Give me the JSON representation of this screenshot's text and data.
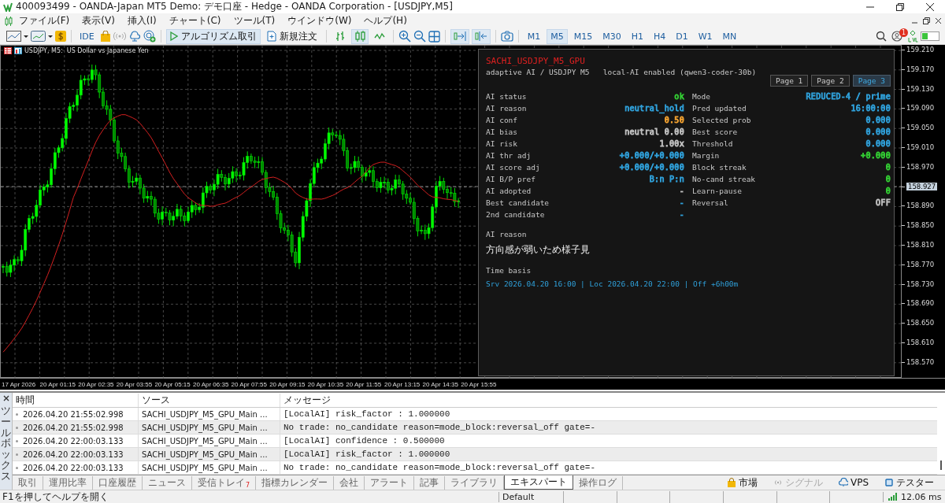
{
  "window": {
    "title": "400093499 - OANDA-Japan MT5 Demo: デモ口座 - Hedge - OANDA Corporation - [USDJPY,M5]"
  },
  "menu": [
    "ファイル(F)",
    "表示(V)",
    "挿入(I)",
    "チャート(C)",
    "ツール(T)",
    "ウインドウ(W)",
    "ヘルプ(H)"
  ],
  "toolbar": {
    "ide_label": "IDE",
    "algo_trading": {
      "label": "アルゴリズム取引",
      "on": true
    },
    "new_order": {
      "label": "新規注文"
    },
    "chart_types": [
      {
        "selected": false
      },
      {
        "selected": true
      },
      {
        "selected": false
      }
    ],
    "autoscroll": {
      "on": true
    },
    "chart_shift": {
      "on": true
    },
    "timeframes": [
      {
        "label": "M1",
        "selected": false
      },
      {
        "label": "M5",
        "selected": true
      },
      {
        "label": "M15",
        "selected": false
      },
      {
        "label": "M30",
        "selected": false
      },
      {
        "label": "H1",
        "selected": false
      },
      {
        "label": "H4",
        "selected": false
      },
      {
        "label": "D1",
        "selected": false
      },
      {
        "label": "W1",
        "selected": false
      },
      {
        "label": "MN",
        "selected": false
      }
    ],
    "notifications_badge": "1"
  },
  "chart": {
    "title": "USDJPY, M5:  US Dollar vs Japanese Yen",
    "price_axis": [
      {
        "label": "159.210",
        "current": false
      },
      {
        "label": "159.170",
        "current": false
      },
      {
        "label": "159.130",
        "current": false
      },
      {
        "label": "159.090",
        "current": false
      },
      {
        "label": "159.050",
        "current": false
      },
      {
        "label": "159.010",
        "current": false
      },
      {
        "label": "158.970",
        "current": false
      },
      {
        "label": "158.927",
        "current": true
      },
      {
        "label": "158.890",
        "current": false
      },
      {
        "label": "158.850",
        "current": false
      },
      {
        "label": "158.810",
        "current": false
      },
      {
        "label": "158.770",
        "current": false
      },
      {
        "label": "158.730",
        "current": false
      },
      {
        "label": "158.690",
        "current": false
      },
      {
        "label": "158.650",
        "current": false
      },
      {
        "label": "158.610",
        "current": false
      },
      {
        "label": "158.570",
        "current": false
      }
    ],
    "time_axis": [
      "17 Apr 2026",
      "20 Apr 01:15",
      "20 Apr 02:35",
      "20 Apr 03:55",
      "20 Apr 05:15",
      "20 Apr 06:35",
      "20 Apr 07:55",
      "20 Apr 09:15",
      "20 Apr 10:35",
      "20 Apr 11:55",
      "20 Apr 13:15",
      "20 Apr 14:35",
      "20 Apr 15:55"
    ]
  },
  "panel": {
    "title": "SACHI_USDJPY_M5_GPU",
    "subtitle": "adaptive AI / USDJPY M5   local-AI enabled (qwen3-coder-30b)",
    "pages": [
      {
        "label": "Page 1",
        "selected": false
      },
      {
        "label": "Page 2",
        "selected": false
      },
      {
        "label": "Page 3",
        "selected": true
      }
    ],
    "left_rows": [
      {
        "label": "AI status",
        "value": "ok",
        "color": "#33cc33"
      },
      {
        "label": "AI reason",
        "value": "neutral_hold",
        "color": "#2f9fd8"
      },
      {
        "label": "AI conf",
        "value": "0.50",
        "color": "#f0a030"
      },
      {
        "label": "AI bias",
        "value": "neutral 0.00",
        "color": "#c0c0c0"
      },
      {
        "label": "AI risk",
        "value": "1.00x",
        "color": "#c0c0c0"
      },
      {
        "label": "AI thr adj",
        "value": "+0.000/+0.000",
        "color": "#2f9fd8"
      },
      {
        "label": "AI score adj",
        "value": "+0.000/+0.000",
        "color": "#2f9fd8"
      },
      {
        "label": "AI B/P pref",
        "value": "B:n P:n",
        "color": "#2f9fd8"
      },
      {
        "label": "AI adopted",
        "value": "-",
        "color": "#c0c0c0"
      },
      {
        "label": "Best candidate",
        "value": "-",
        "color": "#2f9fd8"
      },
      {
        "label": "2nd candidate",
        "value": "-",
        "color": "#2f9fd8"
      }
    ],
    "right_rows": [
      {
        "label": "Mode",
        "value": "REDUCED-4 / prime",
        "color": "#2f9fd8"
      },
      {
        "label": "Pred updated",
        "value": "16:00:00",
        "color": "#2f9fd8"
      },
      {
        "label": "Selected prob",
        "value": "0.000",
        "color": "#2f9fd8"
      },
      {
        "label": "Best score",
        "value": "0.000",
        "color": "#2f9fd8"
      },
      {
        "label": "Threshold",
        "value": "0.000",
        "color": "#2f9fd8"
      },
      {
        "label": "Margin",
        "value": "+0.000",
        "color": "#33cc33"
      },
      {
        "label": "Block streak",
        "value": "0",
        "color": "#33cc33"
      },
      {
        "label": "No-cand streak",
        "value": "0",
        "color": "#33cc33"
      },
      {
        "label": "Learn-pause",
        "value": "0",
        "color": "#33cc33"
      },
      {
        "label": "Reversal",
        "value": "OFF",
        "color": "#c0c0c0"
      }
    ],
    "reason_heading": "AI reason",
    "reason_text": "方向感が弱いため様子見",
    "time_heading": "Time basis",
    "time_line": "Srv 2026.04.20 16:00 | Loc 2026.04.20 22:00 | Off +6h00m"
  },
  "toolbox": {
    "side_label": "ツールボックス",
    "columns": [
      "時間",
      "ソース",
      "メッセージ"
    ],
    "rows": [
      {
        "time": "2026.04.20 21:55:02.998",
        "source": "SACHI_USDJPY_M5_GPU_Main ...",
        "message": "[LocalAI] risk_factor : 1.000000"
      },
      {
        "time": "2026.04.20 21:55:02.998",
        "source": "SACHI_USDJPY_M5_GPU_Main ...",
        "message": "No trade: no_candidate reason=mode_block:reversal_off gate=-"
      },
      {
        "time": "2026.04.20 22:00:03.133",
        "source": "SACHI_USDJPY_M5_GPU_Main ...",
        "message": "[LocalAI] confidence : 0.500000"
      },
      {
        "time": "2026.04.20 22:00:03.133",
        "source": "SACHI_USDJPY_M5_GPU_Main ...",
        "message": "[LocalAI] risk_factor : 1.000000"
      },
      {
        "time": "2026.04.20 22:00:03.133",
        "source": "SACHI_USDJPY_M5_GPU_Main ...",
        "message": "No trade: no_candidate reason=mode_block:reversal_off gate=-"
      }
    ],
    "tabs": [
      {
        "label": "取引",
        "selected": false
      },
      {
        "label": "運用比率",
        "selected": false
      },
      {
        "label": "口座履歴",
        "selected": false
      },
      {
        "label": "ニュース",
        "selected": false
      },
      {
        "label": "受信トレイ",
        "selected": false,
        "badge": "7"
      },
      {
        "label": "指標カレンダー",
        "selected": false
      },
      {
        "label": "会社",
        "selected": false
      },
      {
        "label": "アラート",
        "selected": false
      },
      {
        "label": "記事",
        "selected": false
      },
      {
        "label": "ライブラリ",
        "selected": false
      },
      {
        "label": "エキスパート",
        "selected": true
      },
      {
        "label": "操作ログ",
        "selected": false
      }
    ],
    "services": [
      {
        "label": "市場",
        "disabled": false
      },
      {
        "label": "シグナル",
        "disabled": true
      },
      {
        "label": "VPS",
        "disabled": false
      },
      {
        "label": "テスター",
        "disabled": false
      }
    ]
  },
  "status_bar": {
    "help": "F1を押してヘルプを開く",
    "profile": "Default",
    "ping": "12.06 ms"
  }
}
